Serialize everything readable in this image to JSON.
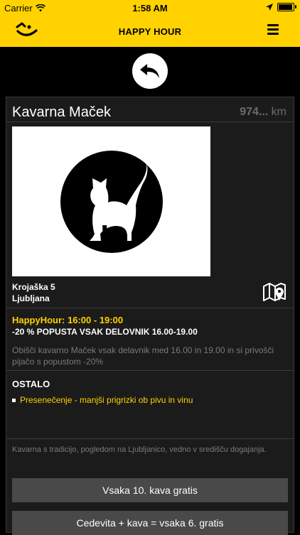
{
  "status_bar": {
    "carrier": "Carrier",
    "time": "1:58 AM"
  },
  "nav": {
    "title": "HAPPY HOUR"
  },
  "venue": {
    "name": "Kavarna Maček",
    "distance_value": "974...",
    "distance_unit": "km",
    "address_line1": "Krojaška 5",
    "address_line2": "Ljubljana"
  },
  "happy_hour": {
    "label": "HappyHour:",
    "time": "16:00 - 19:00",
    "discount": "-20 % POPUSTA VSAK DELOVNIK 16.00-19.00",
    "description": "Obišči kavarno Maček vsak delavnik med 16.00 in 19.00 in si privošči pijačo s popustom -20%"
  },
  "ostalo": {
    "title": "OSTALO",
    "items": [
      "Presenečenje - manjši prigrizki ob pivu in vinu"
    ]
  },
  "about": "Kavarna s tradicijo, pogledom na Ljubljanico, vedno v središču dogajanja.",
  "offers": [
    "Vsaka 10. kava gratis",
    "Cedevita + kava = vsaka 6. gratis"
  ],
  "colors": {
    "accent": "#FFD200",
    "background": "#000000",
    "card": "#1B1B1B",
    "button": "#494949"
  },
  "icons": [
    "wifi-icon",
    "location-arrow-icon",
    "battery-icon",
    "logo-smile-icon",
    "hamburger-menu-icon",
    "back-arrow-icon",
    "map-pin-icon",
    "cat-logo-icon"
  ]
}
